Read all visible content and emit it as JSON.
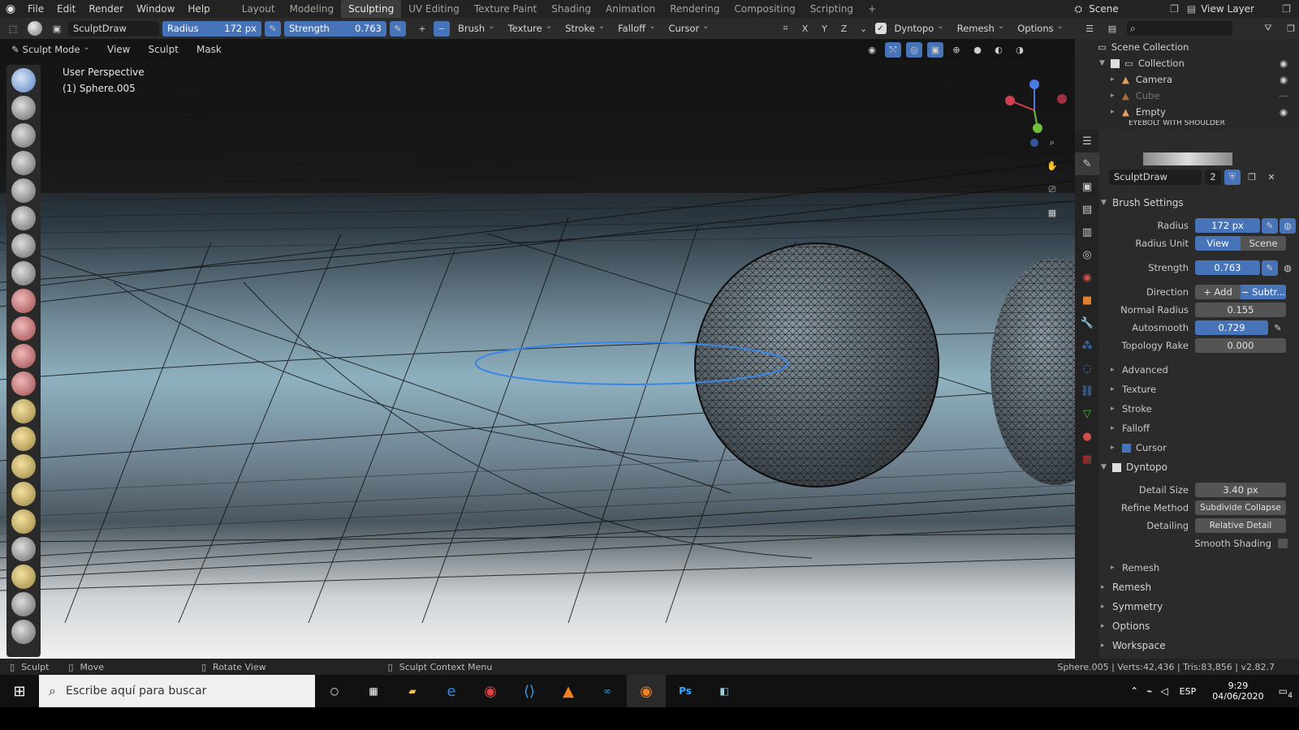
{
  "menu": [
    "File",
    "Edit",
    "Render",
    "Window",
    "Help"
  ],
  "workspaces": [
    "Layout",
    "Modeling",
    "Sculpting",
    "UV Editing",
    "Texture Paint",
    "Shading",
    "Animation",
    "Rendering",
    "Compositing",
    "Scripting"
  ],
  "active_workspace": "Sculpting",
  "scene_name": "Scene",
  "view_layer": "View Layer",
  "tool_header": {
    "brush_name": "SculptDraw",
    "radius_label": "Radius",
    "radius_value": "172 px",
    "strength_label": "Strength",
    "strength_value": "0.763",
    "axis": [
      "X",
      "Y",
      "Z"
    ],
    "menus": [
      "Brush",
      "Texture",
      "Stroke",
      "Falloff",
      "Cursor"
    ],
    "dyntopo": "Dyntopo",
    "remesh": "Remesh",
    "options": "Options"
  },
  "viewport_header": {
    "mode": "Sculpt Mode",
    "menus": [
      "View",
      "Sculpt",
      "Mask"
    ]
  },
  "viewport": {
    "perspective": "User Perspective",
    "object": "(1) Sphere.005"
  },
  "outliner": {
    "root": "Scene Collection",
    "collection": "Collection",
    "items": [
      "Camera",
      "Cube",
      "Empty",
      "EYEBOLT WITH SHOULDER"
    ]
  },
  "properties": {
    "brush_name": "SculptDraw",
    "brush_users": "2",
    "brush_settings": "Brush Settings",
    "radius_label": "Radius",
    "radius_value": "172 px",
    "radius_unit_label": "Radius Unit",
    "radius_unit_view": "View",
    "radius_unit_scene": "Scene",
    "strength_label": "Strength",
    "strength_value": "0.763",
    "direction_label": "Direction",
    "direction_add": "Add",
    "direction_sub": "Subtr...",
    "normal_radius_label": "Normal Radius",
    "normal_radius_value": "0.155",
    "autosmooth_label": "Autosmooth",
    "autosmooth_value": "0.729",
    "topology_rake_label": "Topology Rake",
    "topology_rake_value": "0.000",
    "subsections": [
      "Advanced",
      "Texture",
      "Stroke",
      "Falloff",
      "Cursor"
    ],
    "dyntopo": "Dyntopo",
    "detail_size_label": "Detail Size",
    "detail_size_value": "3.40 px",
    "refine_label": "Refine Method",
    "refine_value": "Subdivide Collapse",
    "detailing_label": "Detailing",
    "detailing_value": "Relative Detail",
    "smooth_shading_label": "Smooth Shading",
    "remesh_sub": "Remesh",
    "sections": [
      "Remesh",
      "Symmetry",
      "Options",
      "Workspace"
    ]
  },
  "status": {
    "sculpt": "Sculpt",
    "move": "Move",
    "rotate": "Rotate View",
    "context": "Sculpt Context Menu",
    "stats": "Sphere.005 | Verts:42,436 | Tris:83,856 | v2.82.7"
  },
  "taskbar": {
    "search_placeholder": "Escribe aquí para buscar",
    "lang": "ESP",
    "time": "9:29",
    "date": "04/06/2020",
    "notif_count": "4"
  },
  "colors": {
    "accent": "#4773b8",
    "panel": "#2b2b2b",
    "header": "#232323"
  }
}
